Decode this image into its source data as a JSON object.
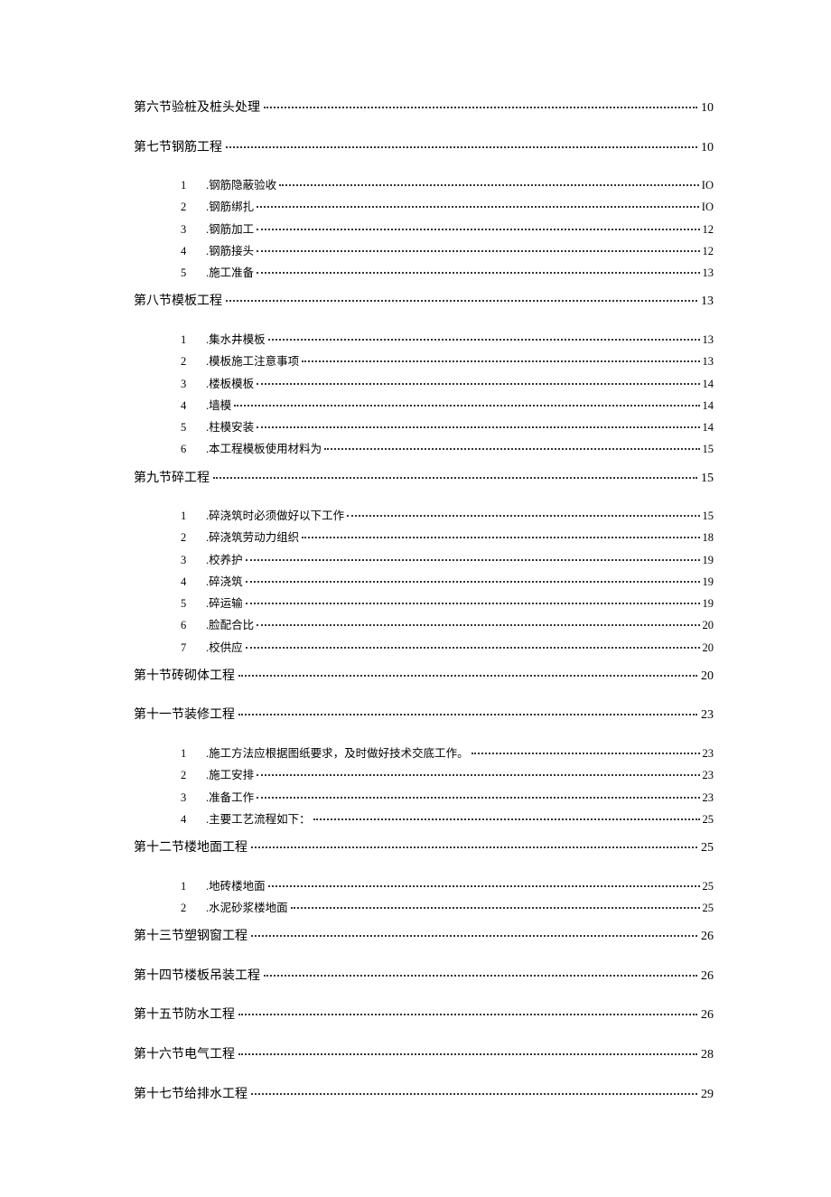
{
  "toc": [
    {
      "type": "section",
      "title": "第六节验桩及桩头处理",
      "page": "10",
      "items": []
    },
    {
      "type": "section",
      "title": "第七节钢筋工程",
      "page": "10",
      "items": [
        {
          "n": "1",
          "t": ".钢筋隐蔽验收",
          "p": "IO"
        },
        {
          "n": "2",
          "t": ".钢筋绑扎",
          "p": "IO"
        },
        {
          "n": "3",
          "t": ".钢筋加工",
          "p": "12"
        },
        {
          "n": "4",
          "t": ".钢筋接头",
          "p": "12"
        },
        {
          "n": "5",
          "t": ".施工准备",
          "p": "13"
        }
      ]
    },
    {
      "type": "section",
      "title": "第八节模板工程",
      "page": "13",
      "items": [
        {
          "n": "1",
          "t": ".集水井模板",
          "p": "13"
        },
        {
          "n": "2",
          "t": ".模板施工注意事项",
          "p": "13"
        },
        {
          "n": "3",
          "t": ".楼板模板",
          "p": "14"
        },
        {
          "n": "4",
          "t": ".墙模",
          "p": "14"
        },
        {
          "n": "5",
          "t": ".柱模安装",
          "p": "14"
        },
        {
          "n": "6",
          "t": ".本工程模板使用材料为",
          "p": "15"
        }
      ]
    },
    {
      "type": "section",
      "title": "第九节碎工程",
      "page": "15",
      "items": [
        {
          "n": "1",
          "t": ".碎浇筑时必须做好以下工作",
          "p": "15"
        },
        {
          "n": "2",
          "t": ".碎浇筑劳动力组织",
          "p": "18"
        },
        {
          "n": "3",
          "t": ".校养护",
          "p": "19"
        },
        {
          "n": "4",
          "t": ".碎浇筑",
          "p": "19"
        },
        {
          "n": "5",
          "t": ".碎运输",
          "p": "19"
        },
        {
          "n": "6",
          "t": ".脸配合比",
          "p": "20"
        },
        {
          "n": "7",
          "t": ".校供应",
          "p": "20"
        }
      ]
    },
    {
      "type": "section",
      "title": "第十节砖砌体工程",
      "page": "20",
      "items": []
    },
    {
      "type": "section",
      "title": "第十一节装修工程",
      "page": "23",
      "items": [
        {
          "n": "1",
          "t": ".施工方法应根据图纸要求，及时做好技术交底工作。",
          "p": "23"
        },
        {
          "n": "2",
          "t": ".施工安排",
          "p": "23"
        },
        {
          "n": "3",
          "t": ".准备工作",
          "p": "23"
        },
        {
          "n": "4",
          "t": ".主要工艺流程如下：",
          "p": "25"
        }
      ]
    },
    {
      "type": "section",
      "title": "第十二节楼地面工程",
      "page": "25",
      "items": [
        {
          "n": "1",
          "t": ".地砖楼地面",
          "p": "25"
        },
        {
          "n": "2",
          "t": ".水泥砂浆楼地面",
          "p": "25"
        }
      ]
    },
    {
      "type": "section",
      "title": "第十三节塑钢窗工程",
      "page": "26",
      "items": []
    },
    {
      "type": "section",
      "title": "第十四节楼板吊装工程",
      "page": "26",
      "items": []
    },
    {
      "type": "section",
      "title": "第十五节防水工程",
      "page": "26",
      "items": []
    },
    {
      "type": "section",
      "title": "第十六节电气工程",
      "page": "28",
      "items": []
    },
    {
      "type": "section",
      "title": "第十七节给排水工程",
      "page": "29",
      "items": []
    }
  ]
}
